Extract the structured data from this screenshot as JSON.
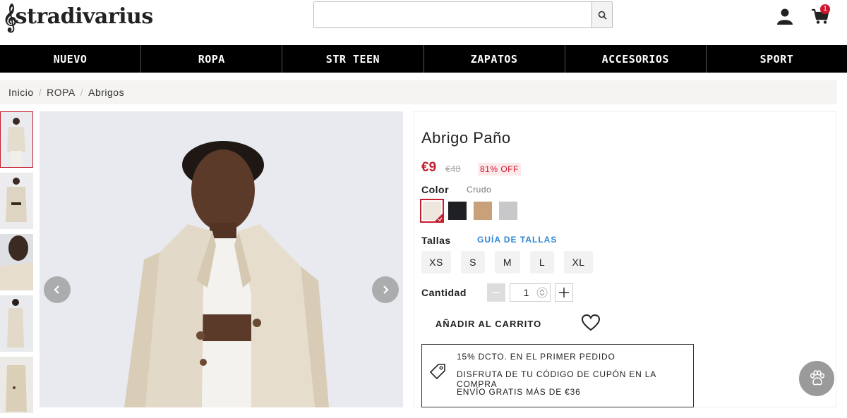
{
  "brand": {
    "logo_text": "stradivarius"
  },
  "search": {
    "value": "",
    "placeholder": ""
  },
  "cart": {
    "count": "1"
  },
  "nav": {
    "items": [
      "NUEVO",
      "ROPA",
      "STR TEEN",
      "ZAPATOS",
      "ACCESORIOS",
      "SPORT"
    ]
  },
  "breadcrumb": {
    "items": [
      "Inicio",
      "ROPA",
      "Abrigos"
    ]
  },
  "product": {
    "title": "Abrigo Paño",
    "price": "€9",
    "old_price": "€48",
    "discount": "81% OFF",
    "color_label": "Color",
    "color_selected": "Crudo",
    "swatches": [
      {
        "name": "crudo",
        "color": "#ece6dc"
      },
      {
        "name": "negro",
        "color": "#1f2023"
      },
      {
        "name": "camel",
        "color": "#c8a07a"
      },
      {
        "name": "gris",
        "color": "#c8c8ca"
      }
    ],
    "sizes_label": "Tallas",
    "size_guide": "GUÍA DE TALLAS",
    "sizes": [
      "XS",
      "S",
      "M",
      "L",
      "XL"
    ],
    "quantity_label": "Cantidad",
    "quantity": "1",
    "add_to_cart": "AÑADIR AL CARRITO"
  },
  "promo": {
    "lines": [
      "15% DCTO. EN EL PRIMER PEDIDO",
      "DISFRUTA DE TU CÓDIGO DE CUPÓN EN LA COMPRA",
      "ENVÍO GRATIS MÁS DE €36"
    ]
  },
  "colors": {
    "accent": "#c41e2f",
    "link": "#2c84d4",
    "nav_bg": "#000000"
  }
}
